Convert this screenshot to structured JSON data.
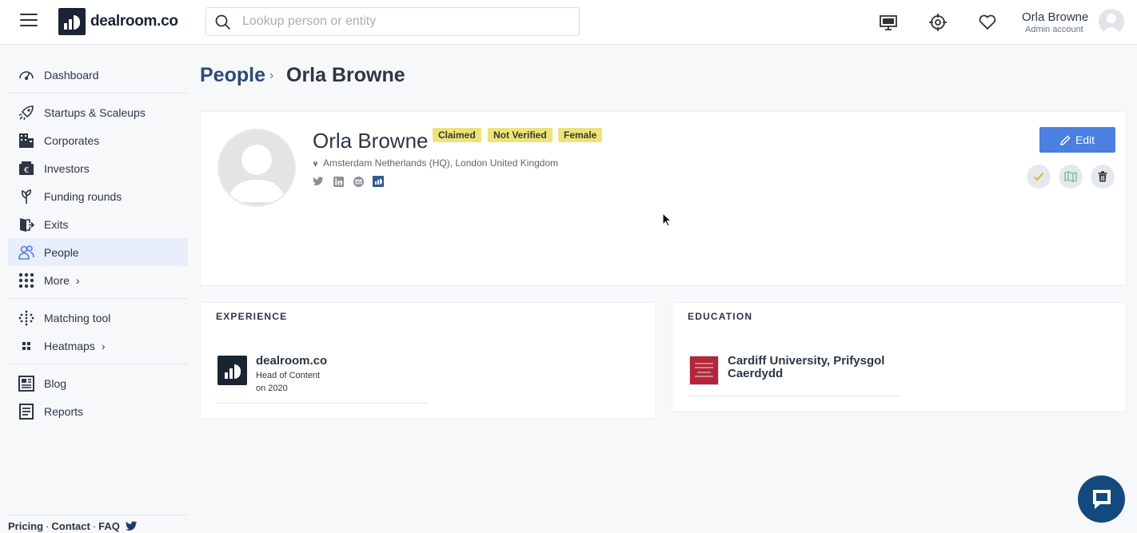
{
  "topbar": {
    "logo_text": "dealroom.co",
    "search_placeholder": "Lookup person or entity",
    "user_name": "Orla Browne",
    "user_role": "Admin account"
  },
  "sidebar": {
    "items": [
      {
        "label": "Dashboard",
        "icon": "dashboard-icon"
      },
      {
        "label": "Startups & Scaleups",
        "icon": "rocket-icon"
      },
      {
        "label": "Corporates",
        "icon": "building-icon"
      },
      {
        "label": "Investors",
        "icon": "wallet-icon"
      },
      {
        "label": "Funding rounds",
        "icon": "seedling-icon"
      },
      {
        "label": "Exits",
        "icon": "exit-icon"
      },
      {
        "label": "People",
        "icon": "people-icon",
        "active": true
      },
      {
        "label": "More",
        "icon": "grid-icon"
      },
      {
        "label": "Matching tool",
        "icon": "dots-icon"
      },
      {
        "label": "Heatmaps",
        "icon": "squares-icon"
      },
      {
        "label": "Blog",
        "icon": "newspaper-icon"
      },
      {
        "label": "Reports",
        "icon": "report-icon"
      }
    ],
    "footer": {
      "pricing": "Pricing",
      "contact": "Contact",
      "faq": "FAQ",
      "sep": "·"
    }
  },
  "breadcrumb": {
    "root": "People",
    "sep": "›",
    "current": "Orla Browne"
  },
  "profile": {
    "name": "Orla Browne",
    "badges": [
      "Claimed",
      "Not Verified",
      "Female"
    ],
    "location": "Amsterdam Netherlands (HQ), London United Kingdom",
    "edit_label": "Edit",
    "colors": {
      "badge": "#eee27a",
      "edit_button": "#4a80e0",
      "accent_link": "#2a4a7a"
    }
  },
  "experience": {
    "title": "EXPERIENCE",
    "entries": [
      {
        "company": "dealroom.co",
        "role": "Head of Content",
        "period": "on 2020"
      }
    ]
  },
  "education": {
    "title": "EDUCATION",
    "entries": [
      {
        "school_line1": "Cardiff University, Prifysgol",
        "school_line2": "Caerdydd"
      }
    ]
  }
}
